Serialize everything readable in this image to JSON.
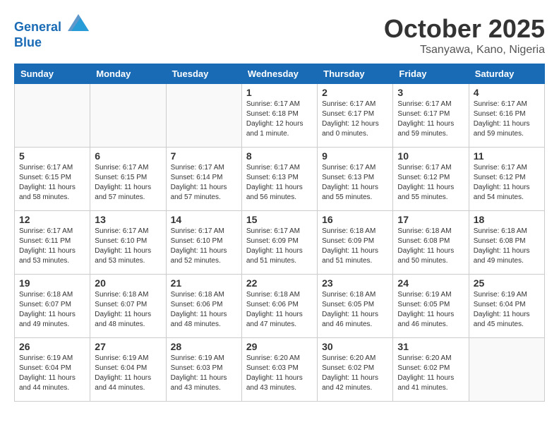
{
  "header": {
    "logo_line1": "General",
    "logo_line2": "Blue",
    "month_title": "October 2025",
    "location": "Tsanyawa, Kano, Nigeria"
  },
  "weekdays": [
    "Sunday",
    "Monday",
    "Tuesday",
    "Wednesday",
    "Thursday",
    "Friday",
    "Saturday"
  ],
  "weeks": [
    [
      {
        "day": "",
        "sunrise": "",
        "sunset": "",
        "daylight": "",
        "empty": true
      },
      {
        "day": "",
        "sunrise": "",
        "sunset": "",
        "daylight": "",
        "empty": true
      },
      {
        "day": "",
        "sunrise": "",
        "sunset": "",
        "daylight": "",
        "empty": true
      },
      {
        "day": "1",
        "sunrise": "Sunrise: 6:17 AM",
        "sunset": "Sunset: 6:18 PM",
        "daylight": "Daylight: 12 hours and 1 minute."
      },
      {
        "day": "2",
        "sunrise": "Sunrise: 6:17 AM",
        "sunset": "Sunset: 6:17 PM",
        "daylight": "Daylight: 12 hours and 0 minutes."
      },
      {
        "day": "3",
        "sunrise": "Sunrise: 6:17 AM",
        "sunset": "Sunset: 6:17 PM",
        "daylight": "Daylight: 11 hours and 59 minutes."
      },
      {
        "day": "4",
        "sunrise": "Sunrise: 6:17 AM",
        "sunset": "Sunset: 6:16 PM",
        "daylight": "Daylight: 11 hours and 59 minutes."
      }
    ],
    [
      {
        "day": "5",
        "sunrise": "Sunrise: 6:17 AM",
        "sunset": "Sunset: 6:15 PM",
        "daylight": "Daylight: 11 hours and 58 minutes."
      },
      {
        "day": "6",
        "sunrise": "Sunrise: 6:17 AM",
        "sunset": "Sunset: 6:15 PM",
        "daylight": "Daylight: 11 hours and 57 minutes."
      },
      {
        "day": "7",
        "sunrise": "Sunrise: 6:17 AM",
        "sunset": "Sunset: 6:14 PM",
        "daylight": "Daylight: 11 hours and 57 minutes."
      },
      {
        "day": "8",
        "sunrise": "Sunrise: 6:17 AM",
        "sunset": "Sunset: 6:13 PM",
        "daylight": "Daylight: 11 hours and 56 minutes."
      },
      {
        "day": "9",
        "sunrise": "Sunrise: 6:17 AM",
        "sunset": "Sunset: 6:13 PM",
        "daylight": "Daylight: 11 hours and 55 minutes."
      },
      {
        "day": "10",
        "sunrise": "Sunrise: 6:17 AM",
        "sunset": "Sunset: 6:12 PM",
        "daylight": "Daylight: 11 hours and 55 minutes."
      },
      {
        "day": "11",
        "sunrise": "Sunrise: 6:17 AM",
        "sunset": "Sunset: 6:12 PM",
        "daylight": "Daylight: 11 hours and 54 minutes."
      }
    ],
    [
      {
        "day": "12",
        "sunrise": "Sunrise: 6:17 AM",
        "sunset": "Sunset: 6:11 PM",
        "daylight": "Daylight: 11 hours and 53 minutes."
      },
      {
        "day": "13",
        "sunrise": "Sunrise: 6:17 AM",
        "sunset": "Sunset: 6:10 PM",
        "daylight": "Daylight: 11 hours and 53 minutes."
      },
      {
        "day": "14",
        "sunrise": "Sunrise: 6:17 AM",
        "sunset": "Sunset: 6:10 PM",
        "daylight": "Daylight: 11 hours and 52 minutes."
      },
      {
        "day": "15",
        "sunrise": "Sunrise: 6:17 AM",
        "sunset": "Sunset: 6:09 PM",
        "daylight": "Daylight: 11 hours and 51 minutes."
      },
      {
        "day": "16",
        "sunrise": "Sunrise: 6:18 AM",
        "sunset": "Sunset: 6:09 PM",
        "daylight": "Daylight: 11 hours and 51 minutes."
      },
      {
        "day": "17",
        "sunrise": "Sunrise: 6:18 AM",
        "sunset": "Sunset: 6:08 PM",
        "daylight": "Daylight: 11 hours and 50 minutes."
      },
      {
        "day": "18",
        "sunrise": "Sunrise: 6:18 AM",
        "sunset": "Sunset: 6:08 PM",
        "daylight": "Daylight: 11 hours and 49 minutes."
      }
    ],
    [
      {
        "day": "19",
        "sunrise": "Sunrise: 6:18 AM",
        "sunset": "Sunset: 6:07 PM",
        "daylight": "Daylight: 11 hours and 49 minutes."
      },
      {
        "day": "20",
        "sunrise": "Sunrise: 6:18 AM",
        "sunset": "Sunset: 6:07 PM",
        "daylight": "Daylight: 11 hours and 48 minutes."
      },
      {
        "day": "21",
        "sunrise": "Sunrise: 6:18 AM",
        "sunset": "Sunset: 6:06 PM",
        "daylight": "Daylight: 11 hours and 48 minutes."
      },
      {
        "day": "22",
        "sunrise": "Sunrise: 6:18 AM",
        "sunset": "Sunset: 6:06 PM",
        "daylight": "Daylight: 11 hours and 47 minutes."
      },
      {
        "day": "23",
        "sunrise": "Sunrise: 6:18 AM",
        "sunset": "Sunset: 6:05 PM",
        "daylight": "Daylight: 11 hours and 46 minutes."
      },
      {
        "day": "24",
        "sunrise": "Sunrise: 6:19 AM",
        "sunset": "Sunset: 6:05 PM",
        "daylight": "Daylight: 11 hours and 46 minutes."
      },
      {
        "day": "25",
        "sunrise": "Sunrise: 6:19 AM",
        "sunset": "Sunset: 6:04 PM",
        "daylight": "Daylight: 11 hours and 45 minutes."
      }
    ],
    [
      {
        "day": "26",
        "sunrise": "Sunrise: 6:19 AM",
        "sunset": "Sunset: 6:04 PM",
        "daylight": "Daylight: 11 hours and 44 minutes."
      },
      {
        "day": "27",
        "sunrise": "Sunrise: 6:19 AM",
        "sunset": "Sunset: 6:04 PM",
        "daylight": "Daylight: 11 hours and 44 minutes."
      },
      {
        "day": "28",
        "sunrise": "Sunrise: 6:19 AM",
        "sunset": "Sunset: 6:03 PM",
        "daylight": "Daylight: 11 hours and 43 minutes."
      },
      {
        "day": "29",
        "sunrise": "Sunrise: 6:20 AM",
        "sunset": "Sunset: 6:03 PM",
        "daylight": "Daylight: 11 hours and 43 minutes."
      },
      {
        "day": "30",
        "sunrise": "Sunrise: 6:20 AM",
        "sunset": "Sunset: 6:02 PM",
        "daylight": "Daylight: 11 hours and 42 minutes."
      },
      {
        "day": "31",
        "sunrise": "Sunrise: 6:20 AM",
        "sunset": "Sunset: 6:02 PM",
        "daylight": "Daylight: 11 hours and 41 minutes."
      },
      {
        "day": "",
        "sunrise": "",
        "sunset": "",
        "daylight": "",
        "empty": true
      }
    ]
  ]
}
